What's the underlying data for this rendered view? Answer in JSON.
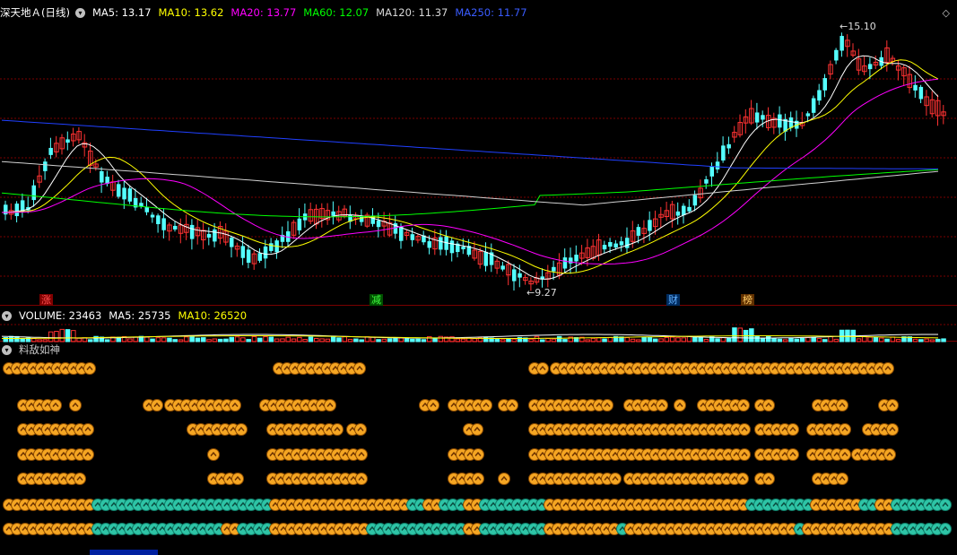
{
  "main_header": {
    "stock_name": "深天地Ａ(日线)",
    "items": [
      {
        "label": "MA5: 13.17",
        "color": "#ffffff"
      },
      {
        "label": "MA10: 13.62",
        "color": "#ffff00"
      },
      {
        "label": "MA20: 13.77",
        "color": "#ff00ff"
      },
      {
        "label": "MA60: 12.07",
        "color": "#00ff00"
      },
      {
        "label": "MA120: 11.37",
        "color": "#d8d8d8"
      },
      {
        "label": "MA250: 11.77",
        "color": "#3a5cff"
      }
    ]
  },
  "price_high_label": "15.10",
  "price_low_label": "9.27",
  "markers": [
    {
      "text": "涨",
      "color": "#ff5050",
      "bg": "#800000"
    },
    {
      "text": "减",
      "color": "#40ff40",
      "bg": "#005000"
    },
    {
      "text": "财",
      "color": "#60b0ff",
      "bg": "#002c60"
    },
    {
      "text": "榜",
      "color": "#ffcc66",
      "bg": "#603000"
    }
  ],
  "volume_header": {
    "items": [
      {
        "label": "VOLUME: 23463",
        "color": "#ffffff"
      },
      {
        "label": "MA5: 25735",
        "color": "#ffffff"
      },
      {
        "label": "MA10: 26520",
        "color": "#ffff00"
      }
    ]
  },
  "indicator_header": {
    "title": "料敌如神"
  },
  "colors": {
    "up": "#ff3232",
    "down": "#54ffff",
    "coin_gold": "#f5a623",
    "coin_teal": "#2ec4a6",
    "grid": "#7a0000"
  },
  "icons": {
    "panel_toggle": "chevron-down-icon",
    "window_restore": "diamond-icon"
  }
}
